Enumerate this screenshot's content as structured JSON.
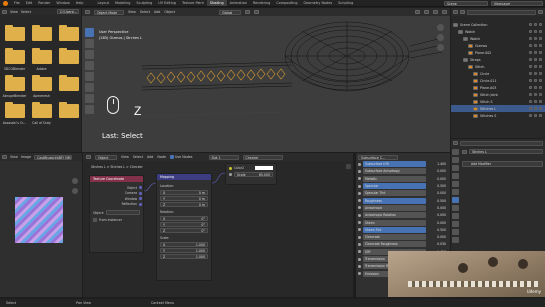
{
  "topbar": {
    "menus": [
      "File",
      "Edit",
      "Render",
      "Window",
      "Help"
    ],
    "workspaces": [
      "Layout",
      "Modeling",
      "Sculpting",
      "UV Editing",
      "Texture Paint",
      "Shading",
      "Animation",
      "Rendering",
      "Compositing",
      "Geometry Nodes",
      "Scripting"
    ],
    "active_workspace": "Shading",
    "scene_name": "Scene",
    "view_layer": "ViewLayer"
  },
  "file_browser": {
    "path": "C:\\Users\\...",
    "view_label": "View",
    "select_label": "Select",
    "folders": [
      {
        "label": ""
      },
      {
        "label": ""
      },
      {
        "label": ""
      },
      {
        "label": "3DCGBlender"
      },
      {
        "label": "Adobe"
      },
      {
        "label": ""
      },
      {
        "label": "AbrupeBlender"
      },
      {
        "label": "Apexmesh"
      },
      {
        "label": ""
      },
      {
        "label": "Assassin's Cr..."
      },
      {
        "label": "Call of Duty"
      },
      {
        "label": ""
      }
    ]
  },
  "viewport": {
    "mode": "Object Mode",
    "menus": [
      "View",
      "Select",
      "Add",
      "Object"
    ],
    "transform": "Global",
    "title": "User Perspective",
    "subtitle": "(285) Gizmos | Strches L",
    "key_shown": "Z",
    "last_op": "Last: Select"
  },
  "image_editor": {
    "menus": [
      "View",
      "Image"
    ],
    "image_name": "CastBlueprintBFI_NM"
  },
  "node_editor": {
    "object_label": "Object",
    "menus": [
      "View",
      "Select",
      "Add",
      "Node"
    ],
    "use_nodes_label": "Use Nodes",
    "slot_label": "Slot 1",
    "material_name": "Checker",
    "breadcrumb": "Strches L   >   Strches L   >   Checker",
    "texcoord": {
      "title": "Texture Coordinate",
      "outputs": [
        "Object",
        "Camera",
        "Window",
        "Reflection"
      ],
      "object_label": "Object:",
      "from_instancer": "From Instancer"
    },
    "mapping": {
      "title": "Mapping",
      "location_label": "Location:",
      "location": [
        "0 m",
        "0 m",
        "0 m"
      ],
      "rotation_label": "Rotation:",
      "rotation": [
        "0°",
        "0°",
        "0°"
      ],
      "scale_label": "Scale:",
      "scale": [
        "1.000",
        "1.000",
        "1.000"
      ],
      "axes": [
        "X",
        "Y",
        "Z"
      ]
    },
    "checker": {
      "color2_label": "Color2",
      "scale_label": "Scale",
      "scale_value": "65.000"
    }
  },
  "properties_mid": {
    "header": "Subsurface C...",
    "rows": [
      {
        "label": "Subsurface IOR",
        "value": "1.400",
        "blue": true
      },
      {
        "label": "Subsurface Anisotropy",
        "value": "0.000",
        "blue": false
      },
      {
        "label": "Metallic",
        "value": "0.000",
        "blue": false
      },
      {
        "label": "Specular",
        "value": "0.500",
        "blue": true
      },
      {
        "label": "Specular Tint",
        "value": "0.000",
        "blue": false
      },
      {
        "label": "Roughness",
        "value": "0.500",
        "blue": true
      },
      {
        "label": "Anisotropic",
        "value": "0.000",
        "blue": false
      },
      {
        "label": "Anisotropic Rotation",
        "value": "0.000",
        "blue": false
      },
      {
        "label": "Sheen",
        "value": "0.000",
        "blue": false
      },
      {
        "label": "Sheen Tint",
        "value": "0.500",
        "blue": true
      },
      {
        "label": "Clearcoat",
        "value": "0.000",
        "blue": false
      },
      {
        "label": "Clearcoat Roughness",
        "value": "0.030",
        "blue": false
      },
      {
        "label": "IOR",
        "value": "1.450",
        "blue": false
      },
      {
        "label": "Transmission",
        "value": "0.000",
        "blue": false
      },
      {
        "label": "Transmission Roughness",
        "value": "0.000",
        "blue": false
      },
      {
        "label": "Emission",
        "value": "",
        "blue": false
      }
    ]
  },
  "outliner": {
    "title": "Scene Collection",
    "rows": [
      {
        "label": "Scene Collection",
        "indent": 0,
        "sel": false
      },
      {
        "label": "Watch",
        "indent": 1,
        "sel": false
      },
      {
        "label": "Watch",
        "indent": 2,
        "sel": false
      },
      {
        "label": "Gizmos",
        "indent": 3,
        "sel": false
      },
      {
        "label": "Plane.002",
        "indent": 3,
        "sel": false
      },
      {
        "label": "Straps",
        "indent": 2,
        "sel": false
      },
      {
        "label": "Stitch",
        "indent": 3,
        "sel": false
      },
      {
        "label": "Circle",
        "indent": 4,
        "sel": false
      },
      {
        "label": "Circle.011",
        "indent": 4,
        "sel": false
      },
      {
        "label": "Plane.003",
        "indent": 4,
        "sel": false
      },
      {
        "label": "Stitch Joint",
        "indent": 4,
        "sel": false
      },
      {
        "label": "Stitch S",
        "indent": 4,
        "sel": false
      },
      {
        "label": "Stitches L",
        "indent": 4,
        "sel": true
      },
      {
        "label": "Stitches S",
        "indent": 4,
        "sel": false
      }
    ]
  },
  "properties_right": {
    "object_name": "Strches L",
    "add_modifier": "Add Modifier"
  },
  "statusbar": {
    "left": "Select",
    "mid": "Pan View",
    "right": "Context Menu",
    "watermark": "Udemy"
  },
  "colors": {
    "accent_blue": "#4772b3",
    "selected_row": "#3d5a8c",
    "folder": "#e0b04a",
    "header_dark": "#2b2b2b"
  }
}
